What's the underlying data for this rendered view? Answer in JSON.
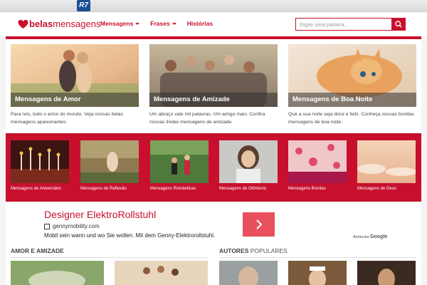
{
  "topbar": {
    "portal_logo": "R7"
  },
  "header": {
    "logo": {
      "bold": "belas",
      "normal": "mensagens"
    },
    "nav": [
      {
        "label": "Mensagens",
        "dropdown": true
      },
      {
        "label": "Frases",
        "dropdown": true
      },
      {
        "label": "Histórias",
        "dropdown": false
      }
    ],
    "search": {
      "placeholder": "Digite uma palavra..."
    }
  },
  "featured": [
    {
      "title": "Mensagens de Amor",
      "description": "Para nós, todo o amor do mundo. Veja nossas belas mensagens apaixonantes."
    },
    {
      "title": "Mensagens de Amizade",
      "description": "Um abraço vale mil palavras. Um amigo mais. Confira nossas lindas mensagens de amizade."
    },
    {
      "title": "Mensagens de Boa Noite",
      "description": "Que a sua noite seja doce e feliz. Conheça nossas bonitas mensagens de boa noite."
    }
  ],
  "categories": [
    {
      "label": "Mensagens de Aniversário"
    },
    {
      "label": "Mensagens de Reflexão"
    },
    {
      "label": "Mensagens Românticas"
    },
    {
      "label": "Mensagens de Otimismo"
    },
    {
      "label": "Mensagens Bonitas"
    },
    {
      "label": "Mensagens de Deus"
    }
  ],
  "ad": {
    "title": "Designer ElektroRollstuhl",
    "url": "gennymobility.com",
    "text": "Mobil sein wann und wo Sie wollen. Mit dem Genny-Elektrorollstuhl.",
    "provider_prefix": "Anúncios",
    "provider": "Google"
  },
  "sections": {
    "left_title": "AMOR E AMIZADE",
    "right_title_bold": "AUTORES",
    "right_title_rest": " POPULARES"
  },
  "colors": {
    "brand_red": "#c8102e",
    "ad_button": "#e8505b"
  }
}
